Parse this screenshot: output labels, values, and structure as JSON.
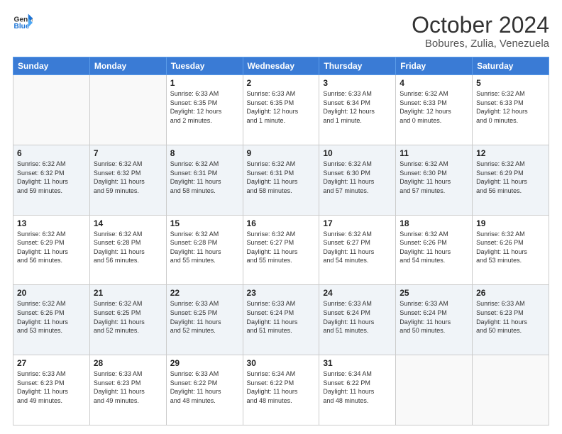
{
  "header": {
    "logo_line1": "General",
    "logo_line2": "Blue",
    "month": "October 2024",
    "location": "Bobures, Zulia, Venezuela"
  },
  "weekdays": [
    "Sunday",
    "Monday",
    "Tuesday",
    "Wednesday",
    "Thursday",
    "Friday",
    "Saturday"
  ],
  "rows": [
    [
      {
        "day": "",
        "info": ""
      },
      {
        "day": "",
        "info": ""
      },
      {
        "day": "1",
        "info": "Sunrise: 6:33 AM\nSunset: 6:35 PM\nDaylight: 12 hours\nand 2 minutes."
      },
      {
        "day": "2",
        "info": "Sunrise: 6:33 AM\nSunset: 6:35 PM\nDaylight: 12 hours\nand 1 minute."
      },
      {
        "day": "3",
        "info": "Sunrise: 6:33 AM\nSunset: 6:34 PM\nDaylight: 12 hours\nand 1 minute."
      },
      {
        "day": "4",
        "info": "Sunrise: 6:32 AM\nSunset: 6:33 PM\nDaylight: 12 hours\nand 0 minutes."
      },
      {
        "day": "5",
        "info": "Sunrise: 6:32 AM\nSunset: 6:33 PM\nDaylight: 12 hours\nand 0 minutes."
      }
    ],
    [
      {
        "day": "6",
        "info": "Sunrise: 6:32 AM\nSunset: 6:32 PM\nDaylight: 11 hours\nand 59 minutes."
      },
      {
        "day": "7",
        "info": "Sunrise: 6:32 AM\nSunset: 6:32 PM\nDaylight: 11 hours\nand 59 minutes."
      },
      {
        "day": "8",
        "info": "Sunrise: 6:32 AM\nSunset: 6:31 PM\nDaylight: 11 hours\nand 58 minutes."
      },
      {
        "day": "9",
        "info": "Sunrise: 6:32 AM\nSunset: 6:31 PM\nDaylight: 11 hours\nand 58 minutes."
      },
      {
        "day": "10",
        "info": "Sunrise: 6:32 AM\nSunset: 6:30 PM\nDaylight: 11 hours\nand 57 minutes."
      },
      {
        "day": "11",
        "info": "Sunrise: 6:32 AM\nSunset: 6:30 PM\nDaylight: 11 hours\nand 57 minutes."
      },
      {
        "day": "12",
        "info": "Sunrise: 6:32 AM\nSunset: 6:29 PM\nDaylight: 11 hours\nand 56 minutes."
      }
    ],
    [
      {
        "day": "13",
        "info": "Sunrise: 6:32 AM\nSunset: 6:29 PM\nDaylight: 11 hours\nand 56 minutes."
      },
      {
        "day": "14",
        "info": "Sunrise: 6:32 AM\nSunset: 6:28 PM\nDaylight: 11 hours\nand 56 minutes."
      },
      {
        "day": "15",
        "info": "Sunrise: 6:32 AM\nSunset: 6:28 PM\nDaylight: 11 hours\nand 55 minutes."
      },
      {
        "day": "16",
        "info": "Sunrise: 6:32 AM\nSunset: 6:27 PM\nDaylight: 11 hours\nand 55 minutes."
      },
      {
        "day": "17",
        "info": "Sunrise: 6:32 AM\nSunset: 6:27 PM\nDaylight: 11 hours\nand 54 minutes."
      },
      {
        "day": "18",
        "info": "Sunrise: 6:32 AM\nSunset: 6:26 PM\nDaylight: 11 hours\nand 54 minutes."
      },
      {
        "day": "19",
        "info": "Sunrise: 6:32 AM\nSunset: 6:26 PM\nDaylight: 11 hours\nand 53 minutes."
      }
    ],
    [
      {
        "day": "20",
        "info": "Sunrise: 6:32 AM\nSunset: 6:26 PM\nDaylight: 11 hours\nand 53 minutes."
      },
      {
        "day": "21",
        "info": "Sunrise: 6:32 AM\nSunset: 6:25 PM\nDaylight: 11 hours\nand 52 minutes."
      },
      {
        "day": "22",
        "info": "Sunrise: 6:33 AM\nSunset: 6:25 PM\nDaylight: 11 hours\nand 52 minutes."
      },
      {
        "day": "23",
        "info": "Sunrise: 6:33 AM\nSunset: 6:24 PM\nDaylight: 11 hours\nand 51 minutes."
      },
      {
        "day": "24",
        "info": "Sunrise: 6:33 AM\nSunset: 6:24 PM\nDaylight: 11 hours\nand 51 minutes."
      },
      {
        "day": "25",
        "info": "Sunrise: 6:33 AM\nSunset: 6:24 PM\nDaylight: 11 hours\nand 50 minutes."
      },
      {
        "day": "26",
        "info": "Sunrise: 6:33 AM\nSunset: 6:23 PM\nDaylight: 11 hours\nand 50 minutes."
      }
    ],
    [
      {
        "day": "27",
        "info": "Sunrise: 6:33 AM\nSunset: 6:23 PM\nDaylight: 11 hours\nand 49 minutes."
      },
      {
        "day": "28",
        "info": "Sunrise: 6:33 AM\nSunset: 6:23 PM\nDaylight: 11 hours\nand 49 minutes."
      },
      {
        "day": "29",
        "info": "Sunrise: 6:33 AM\nSunset: 6:22 PM\nDaylight: 11 hours\nand 48 minutes."
      },
      {
        "day": "30",
        "info": "Sunrise: 6:34 AM\nSunset: 6:22 PM\nDaylight: 11 hours\nand 48 minutes."
      },
      {
        "day": "31",
        "info": "Sunrise: 6:34 AM\nSunset: 6:22 PM\nDaylight: 11 hours\nand 48 minutes."
      },
      {
        "day": "",
        "info": ""
      },
      {
        "day": "",
        "info": ""
      }
    ]
  ]
}
